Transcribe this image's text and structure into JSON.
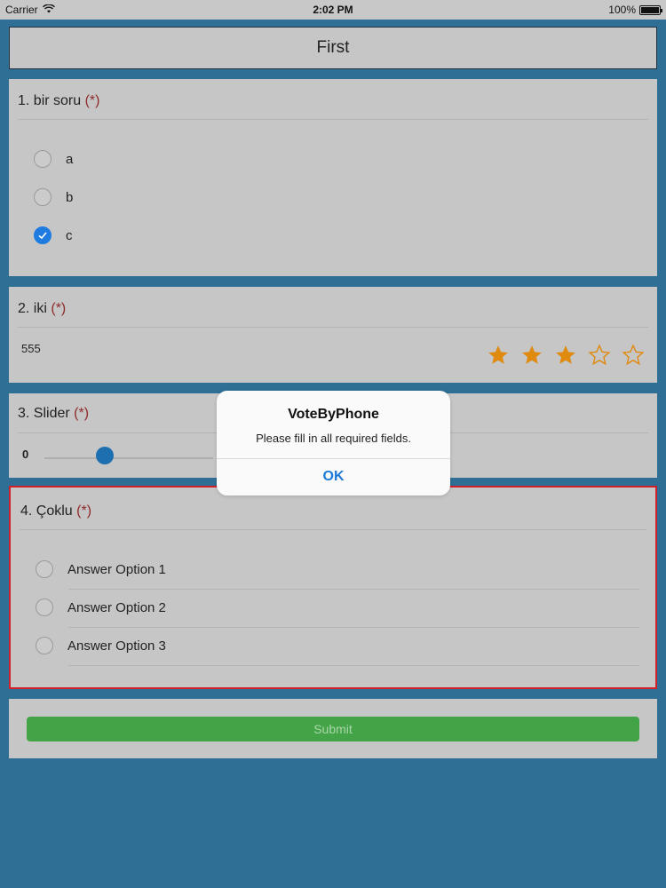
{
  "status_bar": {
    "carrier": "Carrier",
    "time": "2:02 PM",
    "battery": "100%"
  },
  "form": {
    "title": "First",
    "required_marker": "(*)",
    "questions": [
      {
        "title": "1. bir soru",
        "type": "single-choice",
        "options": [
          {
            "label": "a",
            "checked": false
          },
          {
            "label": "b",
            "checked": false
          },
          {
            "label": "c",
            "checked": true
          }
        ]
      },
      {
        "title": "2. iki",
        "type": "rating",
        "value_text": "555",
        "rating": 3,
        "max_rating": 5
      },
      {
        "title": "3. Slider",
        "type": "slider",
        "value_text": "0"
      },
      {
        "title": "4. Çoklu",
        "type": "multi-choice",
        "options": [
          {
            "label": "Answer Option 1",
            "checked": false
          },
          {
            "label": "Answer Option 2",
            "checked": false
          },
          {
            "label": "Answer Option 3",
            "checked": false
          }
        ]
      }
    ],
    "submit_label": "Submit"
  },
  "alert": {
    "title": "VoteByPhone",
    "message": "Please fill in all required fields.",
    "ok_label": "OK"
  },
  "colors": {
    "background": "#2f6f95",
    "card": "#c6c6c6",
    "accent": "#1e7be0",
    "star": "#e08a10",
    "error_border": "#d2202a",
    "submit": "#43a447"
  }
}
